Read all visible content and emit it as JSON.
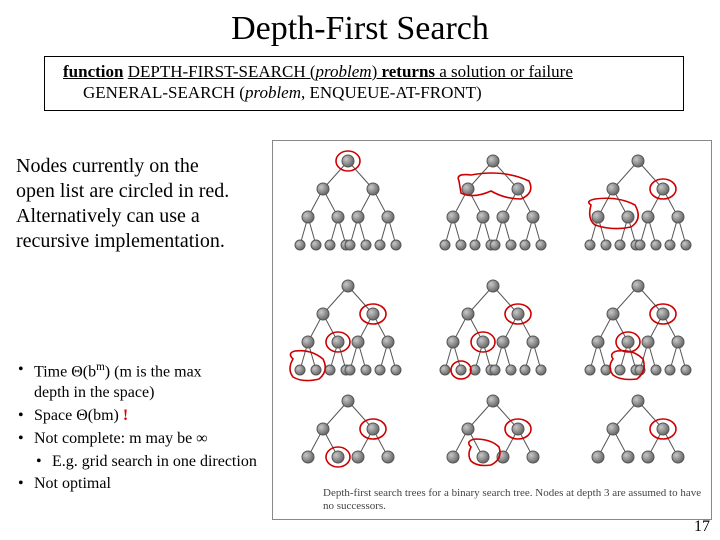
{
  "title": "Depth-First Search",
  "algo": {
    "kw_function": "function",
    "fn_name": "DEPTH-FIRST-SEARCH",
    "open_paren": " (",
    "arg": "problem",
    "close_paren": ") ",
    "kw_returns": "returns",
    "tail": " a solution or failure",
    "line2_fn": "GENERAL-SEARCH (",
    "line2_arg": "problem",
    "line2_tail": ", ENQUEUE-AT-FRONT)"
  },
  "desc": {
    "l1": "Nodes currently on the",
    "l2": "open list are circled in red.",
    "l3": "Alternatively can use a",
    "l4": "recursive implementation."
  },
  "bullets": {
    "b1a": "Time Θ(b",
    "b1b": ") (m is the max",
    "b1c": "depth in the space)",
    "b2a": "Space Θ(bm)  ",
    "b2b": "!",
    "b3a": "Not complete: m may be ∞",
    "b3sub": "E.g. grid search in one direction",
    "b4": "Not optimal"
  },
  "caption": "Depth-first search trees for a binary search tree. Nodes at depth 3 are assumed to have no successors.",
  "pagenum": "17"
}
